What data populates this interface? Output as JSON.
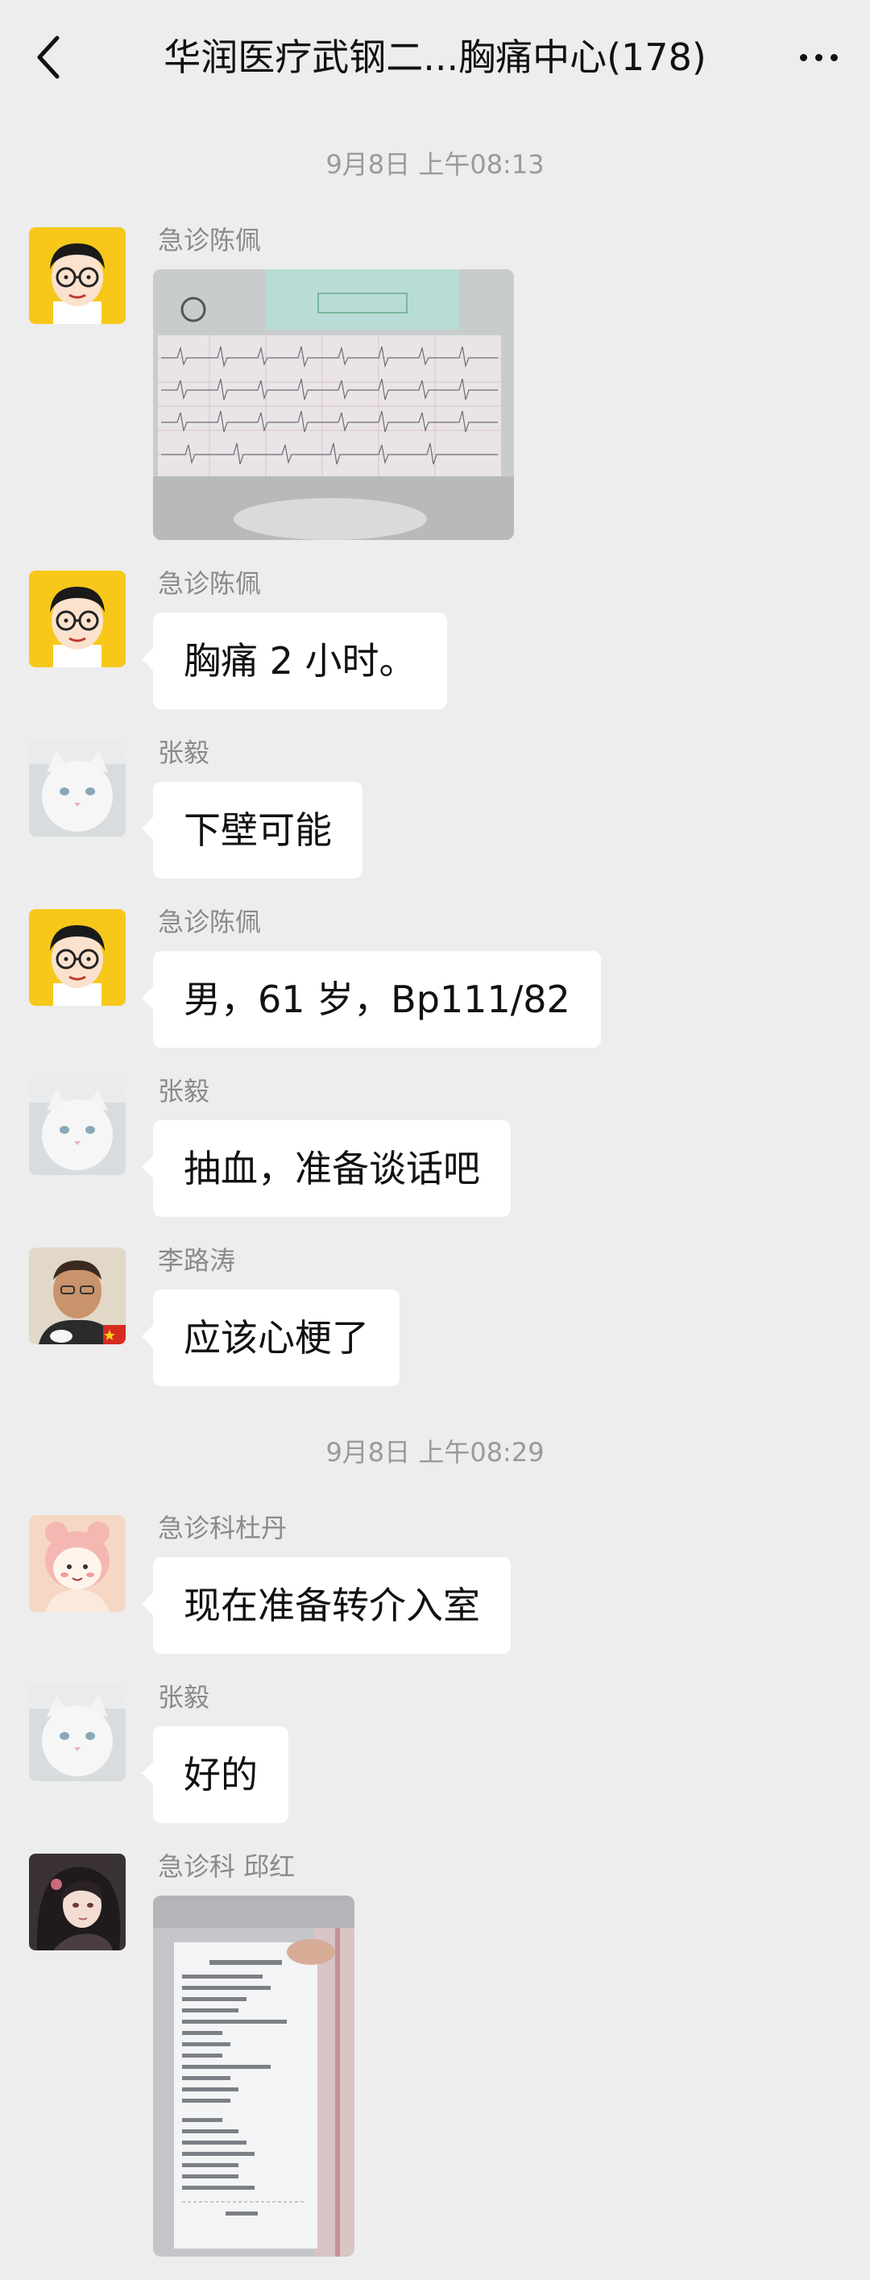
{
  "header": {
    "title": "华润医疗武钢二...胸痛中心(178)",
    "back_icon": "chevron-left-icon",
    "more_icon": "ellipsis-icon"
  },
  "timestamps": [
    "9月8日 上午08:13",
    "9月8日 上午08:29"
  ],
  "messages": [
    {
      "sender": "急诊陈佩",
      "type": "image",
      "content": "ecg-photo"
    },
    {
      "sender": "急诊陈佩",
      "type": "text",
      "text": "胸痛 2 小时。"
    },
    {
      "sender": "张毅",
      "type": "text",
      "text": "下壁可能"
    },
    {
      "sender": "急诊陈佩",
      "type": "text",
      "text": "男，61 岁，Bp111/82"
    },
    {
      "sender": "张毅",
      "type": "text",
      "text": "抽血，准备谈话吧"
    },
    {
      "sender": "李路涛",
      "type": "text",
      "text": "应该心梗了"
    },
    {
      "sender": "急诊科杜丹",
      "type": "text",
      "text": "现在准备转介入室"
    },
    {
      "sender": "张毅",
      "type": "text",
      "text": "好的"
    },
    {
      "sender": "急诊科 邱红",
      "type": "image",
      "content": "lab-receipt-photo"
    }
  ],
  "colors": {
    "background": "#ededed",
    "bubble": "#ffffff",
    "sender_text": "#8a8a8a",
    "timestamp_text": "#9a9a9a"
  }
}
